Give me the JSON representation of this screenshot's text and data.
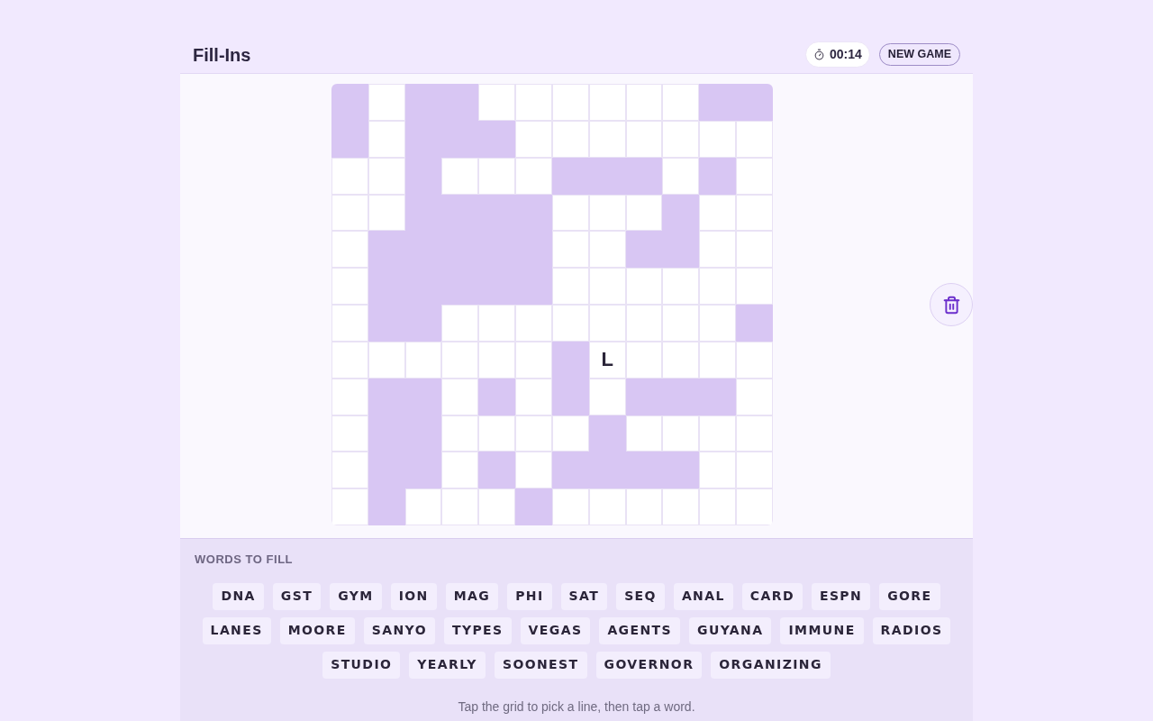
{
  "header": {
    "title": "Fill-Ins",
    "timer": "00:14",
    "new_game_button": "NEW GAME"
  },
  "grid": {
    "rows": [
      {
        "cells": [
          {
            "kind": "block"
          },
          {
            "kind": "open"
          },
          {
            "kind": "block"
          },
          {
            "kind": "block"
          },
          {
            "kind": "open"
          },
          {
            "kind": "open"
          },
          {
            "kind": "open"
          },
          {
            "kind": "open"
          },
          {
            "kind": "open"
          },
          {
            "kind": "open"
          },
          {
            "kind": "block"
          },
          {
            "kind": "block"
          }
        ]
      },
      {
        "cells": [
          {
            "kind": "block"
          },
          {
            "kind": "open"
          },
          {
            "kind": "block"
          },
          {
            "kind": "block"
          },
          {
            "kind": "block"
          },
          {
            "kind": "open"
          },
          {
            "kind": "open"
          },
          {
            "kind": "open"
          },
          {
            "kind": "open"
          },
          {
            "kind": "open"
          },
          {
            "kind": "open"
          },
          {
            "kind": "open"
          }
        ]
      },
      {
        "cells": [
          {
            "kind": "open"
          },
          {
            "kind": "open"
          },
          {
            "kind": "block"
          },
          {
            "kind": "open"
          },
          {
            "kind": "open"
          },
          {
            "kind": "open"
          },
          {
            "kind": "block"
          },
          {
            "kind": "block"
          },
          {
            "kind": "block"
          },
          {
            "kind": "open"
          },
          {
            "kind": "block"
          },
          {
            "kind": "open"
          }
        ]
      },
      {
        "cells": [
          {
            "kind": "open"
          },
          {
            "kind": "open"
          },
          {
            "kind": "block"
          },
          {
            "kind": "block"
          },
          {
            "kind": "block"
          },
          {
            "kind": "block"
          },
          {
            "kind": "open"
          },
          {
            "kind": "open"
          },
          {
            "kind": "open"
          },
          {
            "kind": "block"
          },
          {
            "kind": "open"
          },
          {
            "kind": "open"
          }
        ]
      },
      {
        "cells": [
          {
            "kind": "open"
          },
          {
            "kind": "block"
          },
          {
            "kind": "block"
          },
          {
            "kind": "block"
          },
          {
            "kind": "block"
          },
          {
            "kind": "block"
          },
          {
            "kind": "open"
          },
          {
            "kind": "open"
          },
          {
            "kind": "block"
          },
          {
            "kind": "block"
          },
          {
            "kind": "open"
          },
          {
            "kind": "open"
          }
        ]
      },
      {
        "cells": [
          {
            "kind": "open"
          },
          {
            "kind": "block"
          },
          {
            "kind": "block"
          },
          {
            "kind": "block"
          },
          {
            "kind": "block"
          },
          {
            "kind": "block"
          },
          {
            "kind": "open"
          },
          {
            "kind": "open"
          },
          {
            "kind": "open"
          },
          {
            "kind": "open"
          },
          {
            "kind": "open"
          },
          {
            "kind": "open"
          }
        ]
      },
      {
        "cells": [
          {
            "kind": "open"
          },
          {
            "kind": "block"
          },
          {
            "kind": "block"
          },
          {
            "kind": "open"
          },
          {
            "kind": "open"
          },
          {
            "kind": "open"
          },
          {
            "kind": "open"
          },
          {
            "kind": "open"
          },
          {
            "kind": "open"
          },
          {
            "kind": "open"
          },
          {
            "kind": "open"
          },
          {
            "kind": "block"
          }
        ]
      },
      {
        "cells": [
          {
            "kind": "open"
          },
          {
            "kind": "open"
          },
          {
            "kind": "open"
          },
          {
            "kind": "open"
          },
          {
            "kind": "open"
          },
          {
            "kind": "open"
          },
          {
            "kind": "block"
          },
          {
            "kind": "open",
            "letter": "L"
          },
          {
            "kind": "open"
          },
          {
            "kind": "open"
          },
          {
            "kind": "open"
          },
          {
            "kind": "open"
          }
        ]
      },
      {
        "cells": [
          {
            "kind": "open"
          },
          {
            "kind": "block"
          },
          {
            "kind": "block"
          },
          {
            "kind": "open"
          },
          {
            "kind": "block"
          },
          {
            "kind": "open"
          },
          {
            "kind": "block"
          },
          {
            "kind": "open"
          },
          {
            "kind": "block"
          },
          {
            "kind": "block"
          },
          {
            "kind": "block"
          },
          {
            "kind": "open"
          }
        ]
      },
      {
        "cells": [
          {
            "kind": "open"
          },
          {
            "kind": "block"
          },
          {
            "kind": "block"
          },
          {
            "kind": "open"
          },
          {
            "kind": "open"
          },
          {
            "kind": "open"
          },
          {
            "kind": "open"
          },
          {
            "kind": "block"
          },
          {
            "kind": "open"
          },
          {
            "kind": "open"
          },
          {
            "kind": "open"
          },
          {
            "kind": "open"
          }
        ]
      },
      {
        "cells": [
          {
            "kind": "open"
          },
          {
            "kind": "block"
          },
          {
            "kind": "block"
          },
          {
            "kind": "open"
          },
          {
            "kind": "block"
          },
          {
            "kind": "open"
          },
          {
            "kind": "block"
          },
          {
            "kind": "block"
          },
          {
            "kind": "block"
          },
          {
            "kind": "block"
          },
          {
            "kind": "open"
          },
          {
            "kind": "open"
          }
        ]
      },
      {
        "cells": [
          {
            "kind": "open"
          },
          {
            "kind": "block"
          },
          {
            "kind": "open"
          },
          {
            "kind": "open"
          },
          {
            "kind": "open"
          },
          {
            "kind": "block"
          },
          {
            "kind": "open"
          },
          {
            "kind": "open"
          },
          {
            "kind": "open"
          },
          {
            "kind": "open"
          },
          {
            "kind": "open"
          },
          {
            "kind": "open"
          }
        ]
      }
    ]
  },
  "words_panel": {
    "heading": "WORDS TO FILL",
    "words": [
      "DNA",
      "GST",
      "GYM",
      "ION",
      "MAG",
      "PHI",
      "SAT",
      "SEQ",
      "ANAL",
      "CARD",
      "ESPN",
      "GORE",
      "LANES",
      "MOORE",
      "SANYO",
      "TYPES",
      "VEGAS",
      "AGENTS",
      "GUYANA",
      "IMMUNE",
      "RADIOS",
      "STUDIO",
      "YEARLY",
      "SOONEST",
      "GOVERNOR",
      "ORGANIZING"
    ],
    "hint": "Tap the grid to pick a line, then tap a word."
  }
}
